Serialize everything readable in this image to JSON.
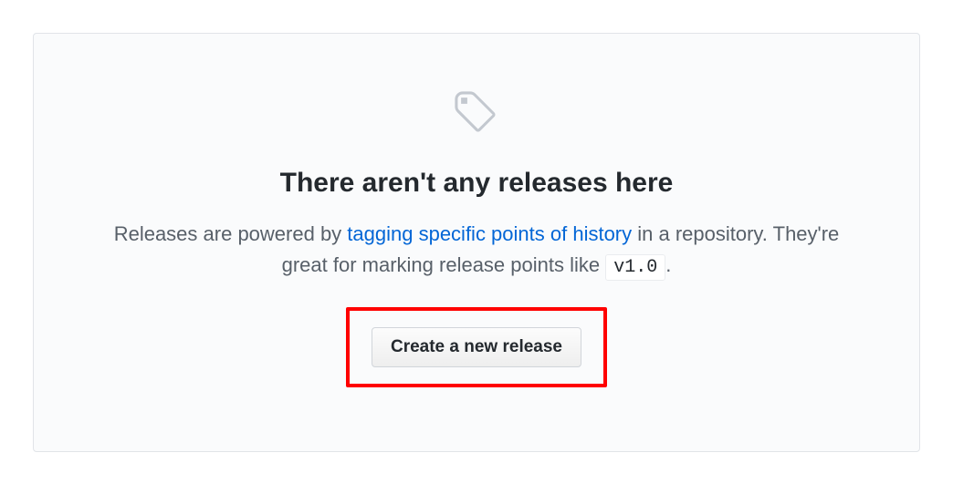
{
  "blankslate": {
    "heading": "There aren't any releases here",
    "desc_before_link": "Releases are powered by ",
    "link_text": "tagging specific points of history",
    "desc_after_link": " in a repository. They're great for marking release points like ",
    "code_example": "v1.0",
    "desc_end": ".",
    "button_label": "Create a new release"
  }
}
